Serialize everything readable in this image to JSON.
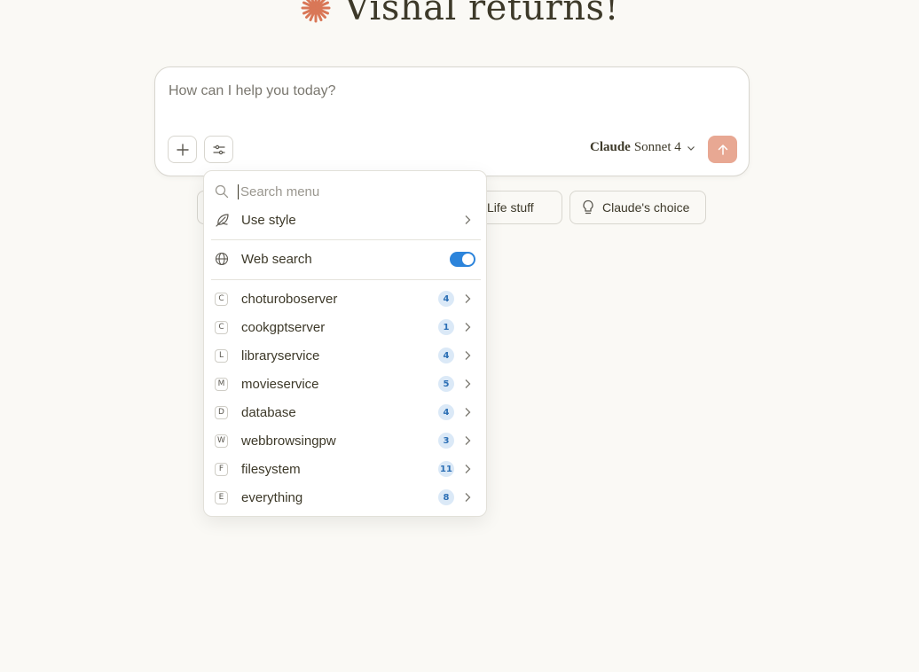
{
  "greeting": {
    "title": "Vishal returns!",
    "spark_color": "#d97757"
  },
  "composer": {
    "placeholder": "How can I help you today?",
    "model_brand": "Claude",
    "model_name": "Sonnet 4",
    "send_color": "#e8a893"
  },
  "chips": [
    {
      "label": "Life stuff",
      "icon": "coffee-icon"
    },
    {
      "label": "Claude's choice",
      "icon": "lightbulb-icon"
    }
  ],
  "menu": {
    "search_placeholder": "Search menu",
    "use_style": "Use style",
    "web_search": {
      "label": "Web search",
      "enabled": true,
      "accent": "#2c84db"
    },
    "servers": [
      {
        "letter": "C",
        "name": "choturoboserver",
        "count": "4"
      },
      {
        "letter": "C",
        "name": "cookgptserver",
        "count": "1"
      },
      {
        "letter": "L",
        "name": "libraryservice",
        "count": "4"
      },
      {
        "letter": "M",
        "name": "movieservice",
        "count": "5"
      },
      {
        "letter": "D",
        "name": "database",
        "count": "4"
      },
      {
        "letter": "W",
        "name": "webbrowsingpw",
        "count": "3"
      },
      {
        "letter": "F",
        "name": "filesystem",
        "count": "11"
      },
      {
        "letter": "E",
        "name": "everything",
        "count": "8"
      }
    ]
  }
}
